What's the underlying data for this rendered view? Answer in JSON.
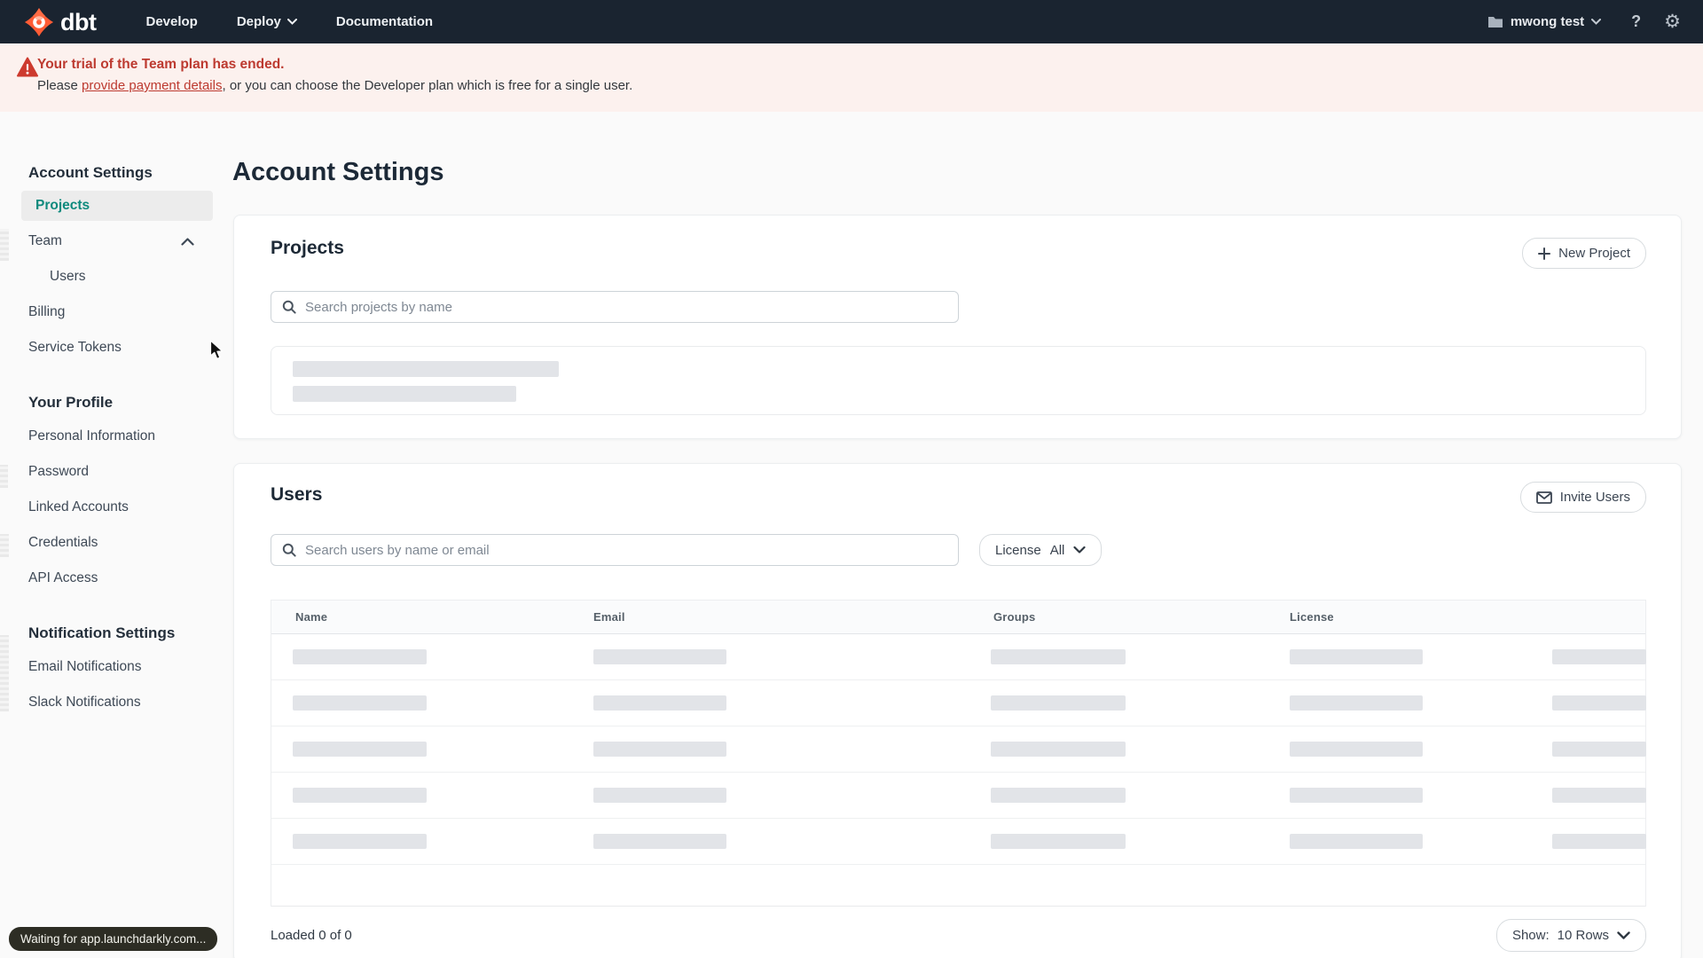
{
  "nav": {
    "logo": "dbt",
    "develop": "Develop",
    "deploy": "Deploy",
    "documentation": "Documentation",
    "account": "mwong test",
    "help": "?"
  },
  "icons": {
    "gear": "⚙"
  },
  "colors": {
    "brand_orange": "#ff5c35",
    "nav_bg": "#1a2430",
    "banner_bg": "#fcf1ee",
    "alert_red": "#bd3a30",
    "active_teal": "#0e8a7d",
    "skeleton_gray": "#e2e4e8"
  },
  "banner": {
    "title": "Your trial of the Team plan has ended.",
    "body_prefix": "Please ",
    "link": "provide payment details",
    "body_suffix": ", or you can choose the Developer plan which is free for a single user."
  },
  "sidebar": {
    "heading_account": "Account Settings",
    "projects": "Projects",
    "team": "Team",
    "users": "Users",
    "billing": "Billing",
    "service_tokens": "Service Tokens",
    "heading_profile": "Your Profile",
    "personal_information": "Personal Information",
    "password": "Password",
    "linked_accounts": "Linked Accounts",
    "credentials": "Credentials",
    "api_access": "API Access",
    "heading_notifications": "Notification Settings",
    "email_notifications": "Email Notifications",
    "slack_notifications": "Slack Notifications"
  },
  "main": {
    "title": "Account Settings",
    "projects": {
      "title": "Projects",
      "new_button": "New Project",
      "search_placeholder": "Search projects by name"
    },
    "users": {
      "title": "Users",
      "invite_button": "Invite Users",
      "search_placeholder": "Search users by name or email",
      "license_label": "License",
      "license_value": "All",
      "headers": [
        "Name",
        "Email",
        "Groups",
        "License"
      ],
      "loaded": "Loaded 0 of 0",
      "show_label": "Show:",
      "show_value": "10 Rows"
    }
  },
  "status": {
    "text": "Waiting for app.launchdarkly.com..."
  }
}
